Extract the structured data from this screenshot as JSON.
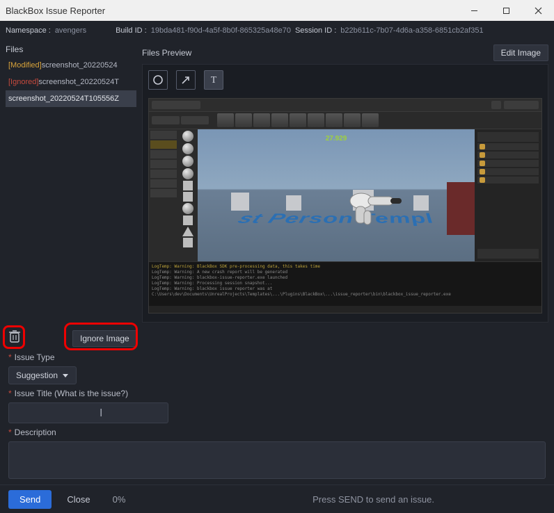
{
  "window": {
    "title": "BlackBox Issue Reporter"
  },
  "meta": {
    "namespace_label": "Namespace  :",
    "namespace_value": "avengers",
    "build_label": "Build ID  :",
    "build_value": "19bda481-f90d-4a5f-8b0f-865325a48e70",
    "session_label": "Session ID  :",
    "session_value": "b22b611c-7b07-4d6a-a358-6851cb2af351"
  },
  "files": {
    "heading": "Files",
    "items": [
      {
        "tag": "[Modified]",
        "tag_class": "tag-mod",
        "name": "screenshot_20220524"
      },
      {
        "tag": "[Ignored]",
        "tag_class": "tag-ign",
        "name": "screenshot_20220524T"
      },
      {
        "tag": "",
        "tag_class": "",
        "name": "screenshot_20220524T105556Z"
      }
    ],
    "selected_index": 2
  },
  "preview": {
    "heading": "Files Preview",
    "edit_btn": "Edit Image",
    "floor_text": "st Person Templ",
    "score_text": "27.929",
    "console_lines": [
      "LogTemp: Warning: BlackBox SDK pre-processing data, this takes time",
      "LogTemp: Warning: A new crash report will be generated",
      "LogTemp: Warning: blackbox-issue-reporter.exe launched",
      "LogTemp: Warning: Processing session snapshot...",
      "LogTemp: Warning: blackbox issue reporter was at C:\\Users\\dev\\Documents\\UnrealProjects\\Templates\\...\\Plugins\\BlackBox\\...\\issue_reporter\\bin\\blackbox_issue_reporter.exe"
    ]
  },
  "actions": {
    "ignore_btn": "Ignore Image"
  },
  "form": {
    "issue_type_label": "Issue Type",
    "issue_type_value": "Suggestion",
    "issue_title_label": "Issue Title (What is the issue?)",
    "issue_title_value": "",
    "description_label": "Description"
  },
  "footer": {
    "send": "Send",
    "close": "Close",
    "percent": "0%",
    "hint": "Press SEND to send an issue."
  }
}
